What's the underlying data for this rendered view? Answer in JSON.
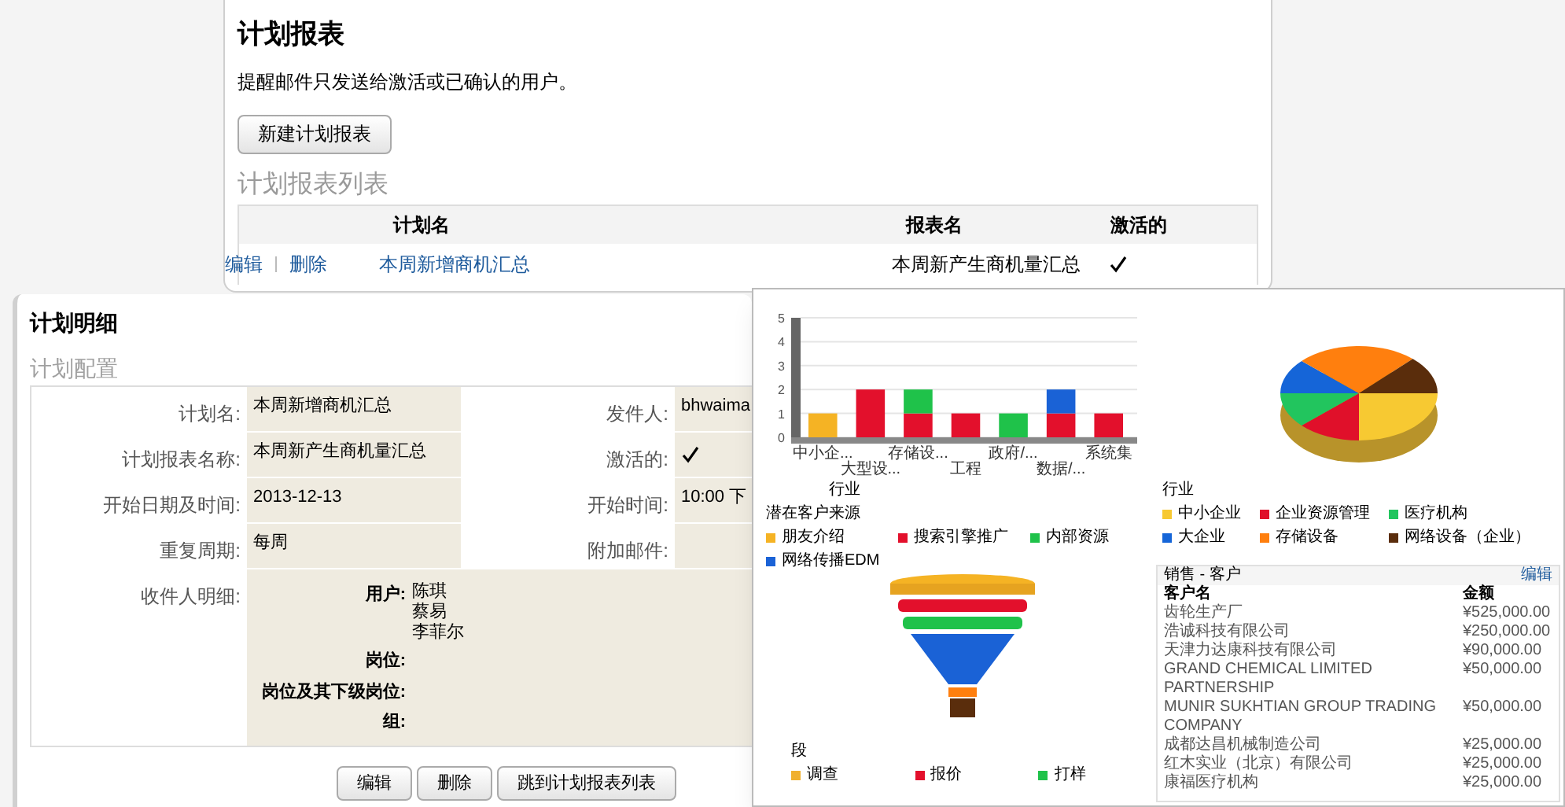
{
  "report_panel": {
    "title": "计划报表",
    "note": "提醒邮件只发送给激活或已确认的用户。",
    "new_button": "新建计划报表",
    "list_heading": "计划报表列表",
    "table": {
      "columns": [
        "计划名",
        "报表名",
        "激活的"
      ],
      "rows": [
        {
          "actions": [
            "编辑",
            "删除"
          ],
          "plan_name": "本周新增商机汇总",
          "report_name": "本周新产生商机量汇总",
          "active": true
        }
      ]
    }
  },
  "detail_panel": {
    "title": "计划明细",
    "section": "计划配置",
    "rows": [
      {
        "label": "计划名:",
        "value": "本周新增商机汇总",
        "side": {
          "label": "发件人:",
          "kind": "text",
          "value": "bhwaima"
        }
      },
      {
        "label": "计划报表名称:",
        "value": "本周新产生商机量汇总",
        "side": {
          "label": "激活的:",
          "kind": "check",
          "checked": true
        }
      },
      {
        "label": "开始日期及时间:",
        "value": "2013-12-13",
        "side": {
          "label": "开始时间:",
          "kind": "text",
          "value": "10:00 下"
        }
      },
      {
        "label": "重复周期:",
        "value": "每周",
        "side": {
          "label": "附加邮件:",
          "kind": "text"
        }
      }
    ],
    "recipients": {
      "label": "收件人明细:",
      "groups": [
        {
          "label": "用户:",
          "names": [
            "陈琪",
            "蔡易",
            "李菲尔"
          ]
        },
        {
          "label": "岗位:"
        },
        {
          "label": "岗位及其下级岗位:"
        },
        {
          "label": "组:"
        }
      ]
    },
    "buttons": [
      "编辑",
      "删除",
      "跳到计划报表列表"
    ]
  },
  "dashboard": {
    "bar_chart": {
      "legend_title": "潜在客户来源",
      "chart_data": {
        "type": "bar",
        "xlabel": "行业",
        "categories": [
          "中小企...",
          "大型设...",
          "存储设...",
          "工程",
          "政府/...",
          "数据/...",
          "系统集"
        ],
        "stacked": true,
        "grid": true,
        "ylim": [
          0,
          5
        ],
        "yticks": [
          0,
          1,
          2,
          3,
          4,
          5
        ],
        "series": [
          {
            "name": "朋友介绍",
            "color": "#f5b324",
            "values": [
              1,
              0,
              0,
              0,
              0,
              0,
              0
            ]
          },
          {
            "name": "搜索引擎推广",
            "color": "#e3102c",
            "values": [
              0,
              2,
              1,
              1,
              0,
              1,
              1
            ]
          },
          {
            "name": "内部资源",
            "color": "#1fc24a",
            "values": [
              0,
              0,
              1,
              0,
              1,
              0,
              0
            ]
          },
          {
            "name": "网络传播EDM",
            "color": "#1a62d6",
            "values": [
              0,
              0,
              0,
              0,
              0,
              1,
              0
            ]
          }
        ]
      }
    },
    "pie": {
      "legend_title": "行业",
      "items": [
        {
          "label": "中小企业",
          "color": "#f7c932"
        },
        {
          "label": "企业资源管理",
          "color": "#e0102a"
        },
        {
          "label": "医疗机构",
          "color": "#22c55e"
        },
        {
          "label": "大企业",
          "color": "#1565d8"
        },
        {
          "label": "存储设备",
          "color": "#ff7f0e"
        },
        {
          "label": "网络设备（企业）",
          "color": "#5a2d0c"
        }
      ]
    },
    "funnel": {
      "legend_title": "段",
      "items": [
        {
          "label": "调查",
          "color": "#f0b030"
        },
        {
          "label": "报价",
          "color": "#e3102c"
        },
        {
          "label": "打样",
          "color": "#1fc24a"
        }
      ]
    },
    "table": {
      "title": "销售 - 客户",
      "edit_link": "编辑",
      "columns": [
        "客户名",
        "金额"
      ],
      "rows": [
        [
          "齿轮生产厂",
          "¥525,000.00"
        ],
        [
          "浩诚科技有限公司",
          "¥250,000.00"
        ],
        [
          "天津力达康科技有限公司",
          "¥90,000.00"
        ],
        [
          "GRAND CHEMICAL LIMITED PARTNERSHIP",
          "¥50,000.00"
        ],
        [
          "MUNIR SUKHTIAN GROUP TRADING COMPANY",
          "¥50,000.00"
        ],
        [
          "成都达昌机械制造公司",
          "¥25,000.00"
        ],
        [
          "红木实业（北京）有限公司",
          "¥25,000.00"
        ],
        [
          "康福医疗机构",
          "¥25,000.00"
        ]
      ]
    }
  }
}
